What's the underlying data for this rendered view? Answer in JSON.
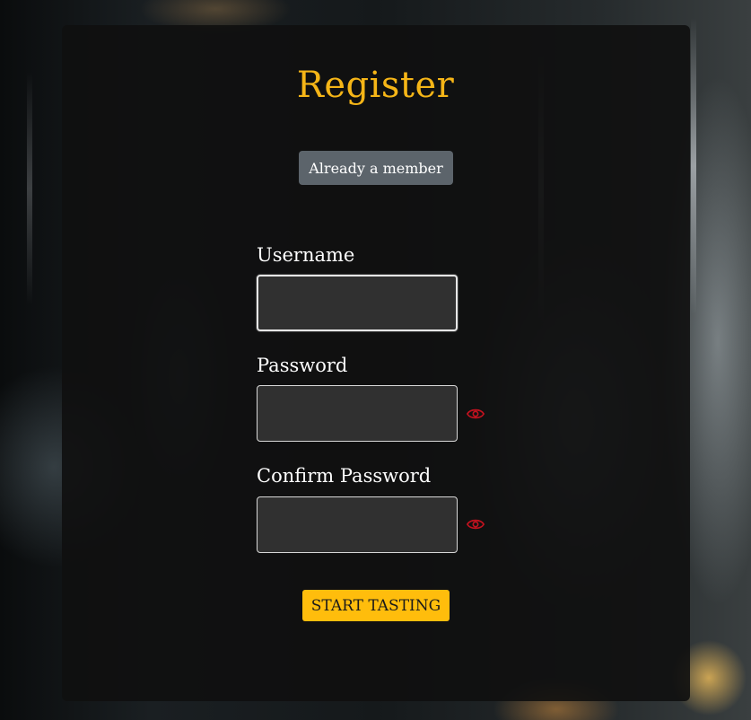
{
  "page": {
    "title": "Register"
  },
  "member_button": {
    "label": "Already a member"
  },
  "form": {
    "username": {
      "label": "Username",
      "value": "",
      "placeholder": ""
    },
    "password": {
      "label": "Password",
      "value": "",
      "placeholder": "",
      "toggle_icon": "eye-icon"
    },
    "confirm_password": {
      "label": "Confirm Password",
      "value": "",
      "placeholder": "",
      "toggle_icon": "eye-icon"
    }
  },
  "submit_button": {
    "label": "START TASTING"
  },
  "colors": {
    "accent": "#f5b517",
    "button_primary": "#ffbd0c",
    "button_secondary": "#5c646b",
    "eye_icon": "#c1121f",
    "panel": "#101010",
    "input_bg": "#303030"
  }
}
